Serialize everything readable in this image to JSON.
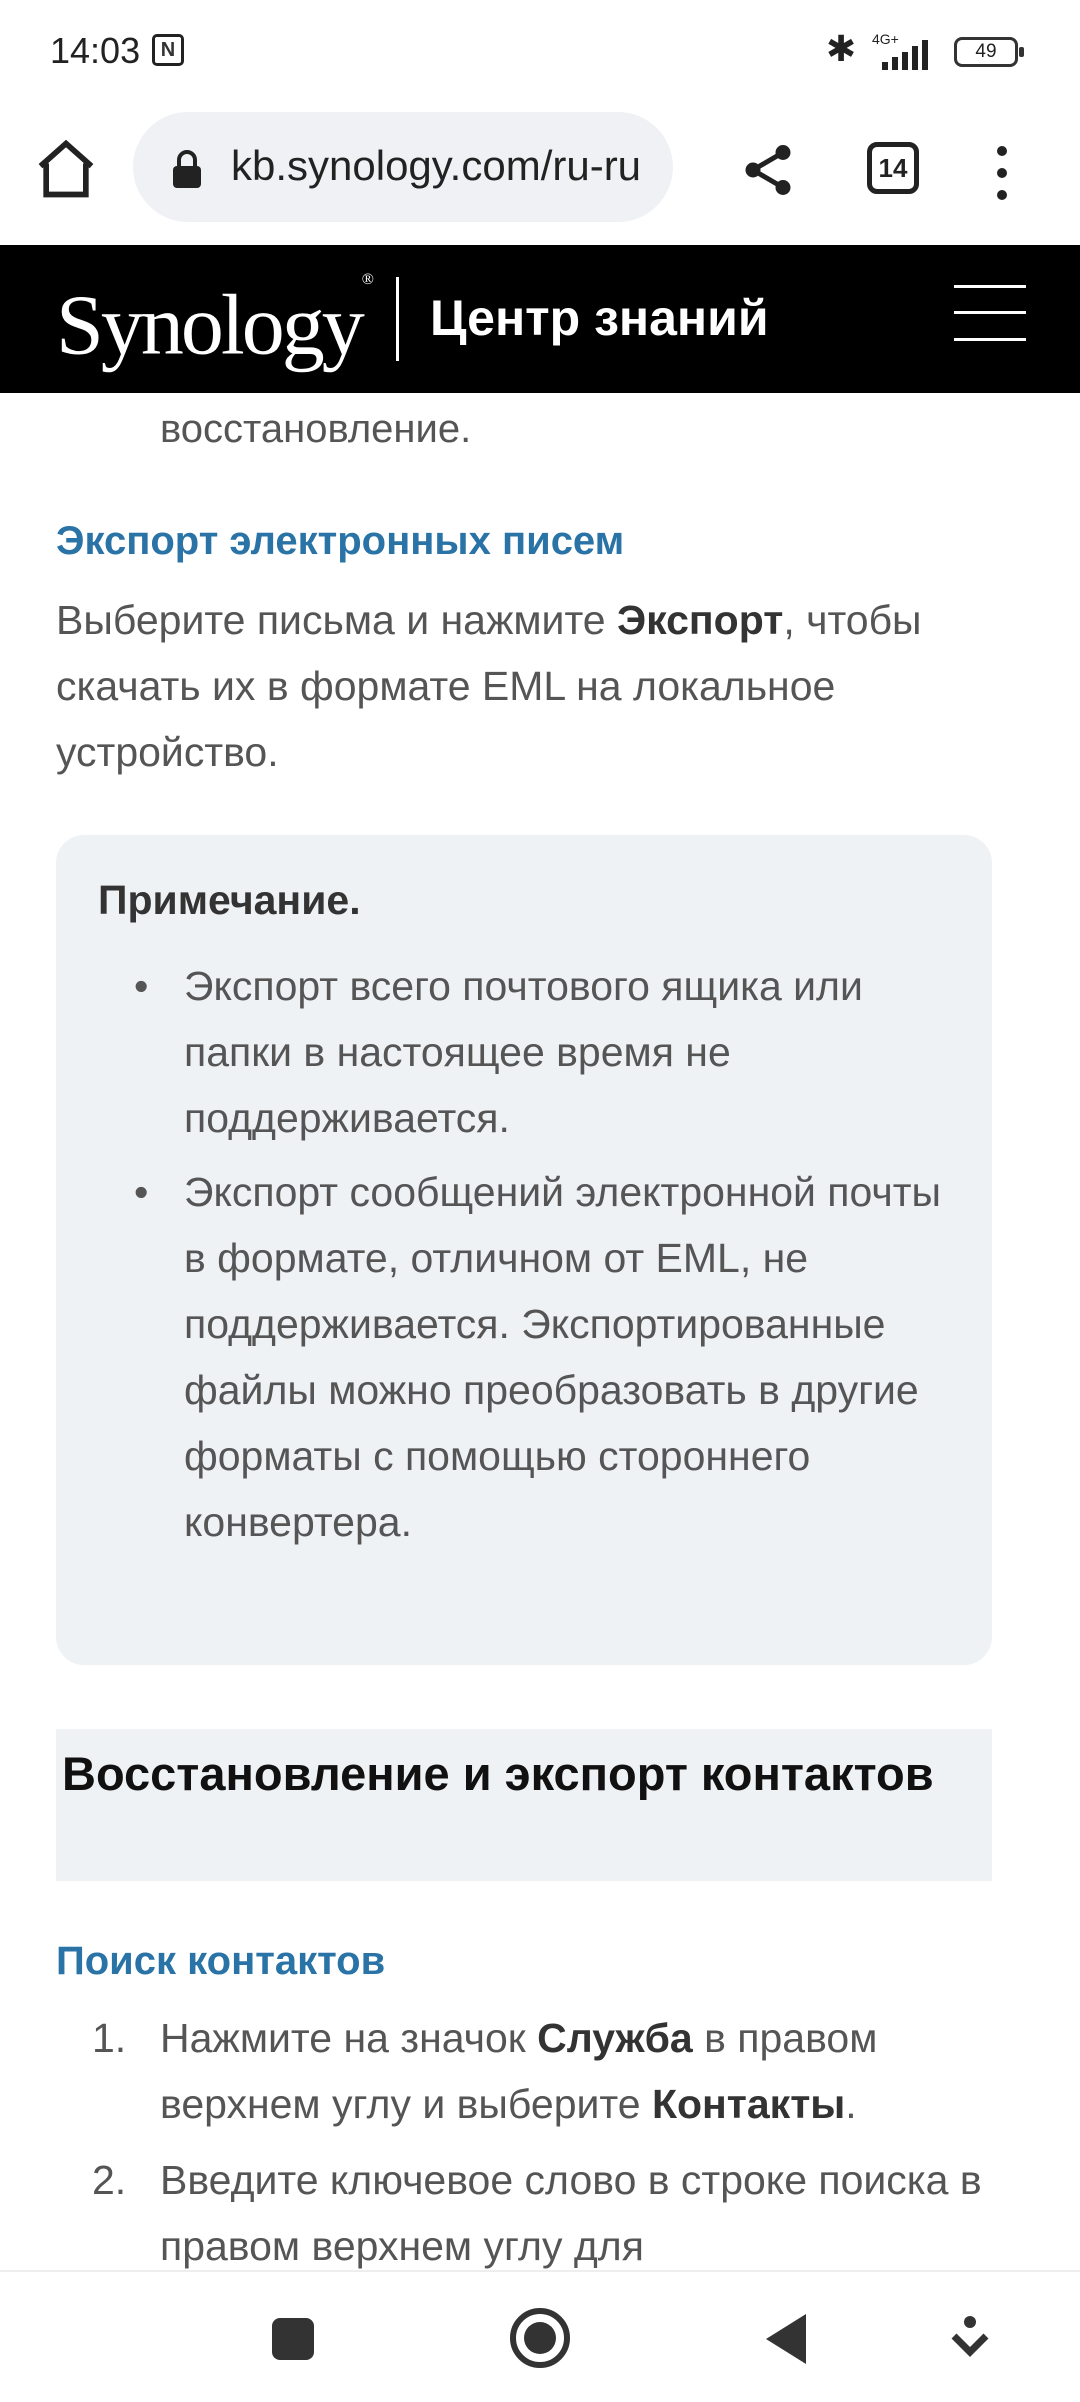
{
  "status_bar": {
    "time": "14:03",
    "network": "4G+",
    "battery": "49"
  },
  "browser": {
    "url": "kb.synology.com/ru-ru",
    "tab_count": "14"
  },
  "site": {
    "logo": "Synology",
    "logo_mark": "®",
    "title": "Центр знаний"
  },
  "content": {
    "cont_text": "восстановление.",
    "export_heading": "Экспорт электронных писем",
    "export_para_1": "Выберите письма и нажмите ",
    "export_bold": "Экспорт",
    "export_para_2": ", чтобы скачать их в формате EML на локальное устройство.",
    "note_title": "Примечание.",
    "note_items": [
      "Экспорт всего почтового ящика или папки в настоящее время не поддерживается.",
      "Экспорт сообщений электронной почты в формате, отличном от EML, не поддерживается. Экспортированные файлы можно преобразовать в другие форматы с помощью стороннего конвертера."
    ],
    "section_heading": "Восстановление и экспорт контактов",
    "search_heading": "Поиск контактов",
    "steps": [
      {
        "num": "1.",
        "t1": "Нажмите на значок ",
        "b1": "Служба",
        "t2": " в правом верхнем углу и выберите ",
        "b2": "Контакты",
        "t3": "."
      },
      {
        "num": "2.",
        "t1": "Введите ключевое слово в строке поиска в правом верхнем углу для"
      }
    ]
  },
  "icons": {
    "home": "home-icon",
    "lock": "lock-icon",
    "share": "share-icon",
    "menu": "more-vert-icon",
    "hamburger": "hamburger-icon"
  }
}
